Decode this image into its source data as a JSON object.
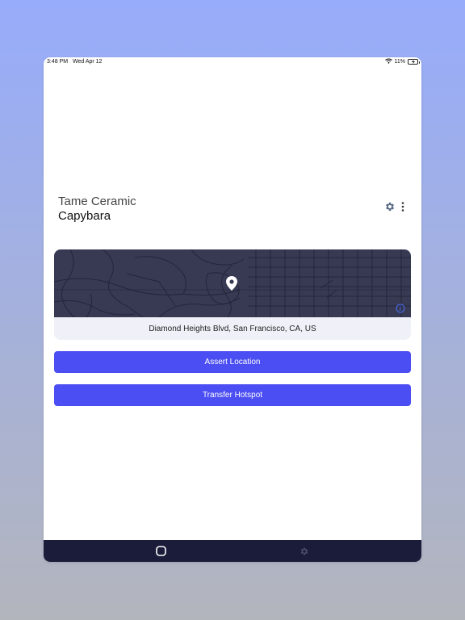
{
  "status_bar": {
    "time": "3:48 PM",
    "date": "Wed Apr 12",
    "battery": "11%",
    "icons": [
      "wifi-icon",
      "battery-charging-icon"
    ]
  },
  "hotspot": {
    "name_line1": "Tame Ceramic",
    "name_line2": "Capybara"
  },
  "header_actions": {
    "icons": [
      "gear-icon",
      "more-vertical-icon"
    ]
  },
  "map": {
    "address": "Diamond Heights Blvd, San Francisco, CA, US",
    "icons": [
      "location-pin-icon",
      "info-icon"
    ]
  },
  "actions": {
    "assert_label": "Assert Location",
    "transfer_label": "Transfer Hotspot"
  },
  "tab_bar": {
    "icons": [
      "home-icon",
      "settings-icon"
    ]
  },
  "colors": {
    "accent": "#4b4ef2",
    "map_background": "#383a54",
    "tab_bar": "#1a1c3a",
    "gear": "#5b6c86"
  }
}
